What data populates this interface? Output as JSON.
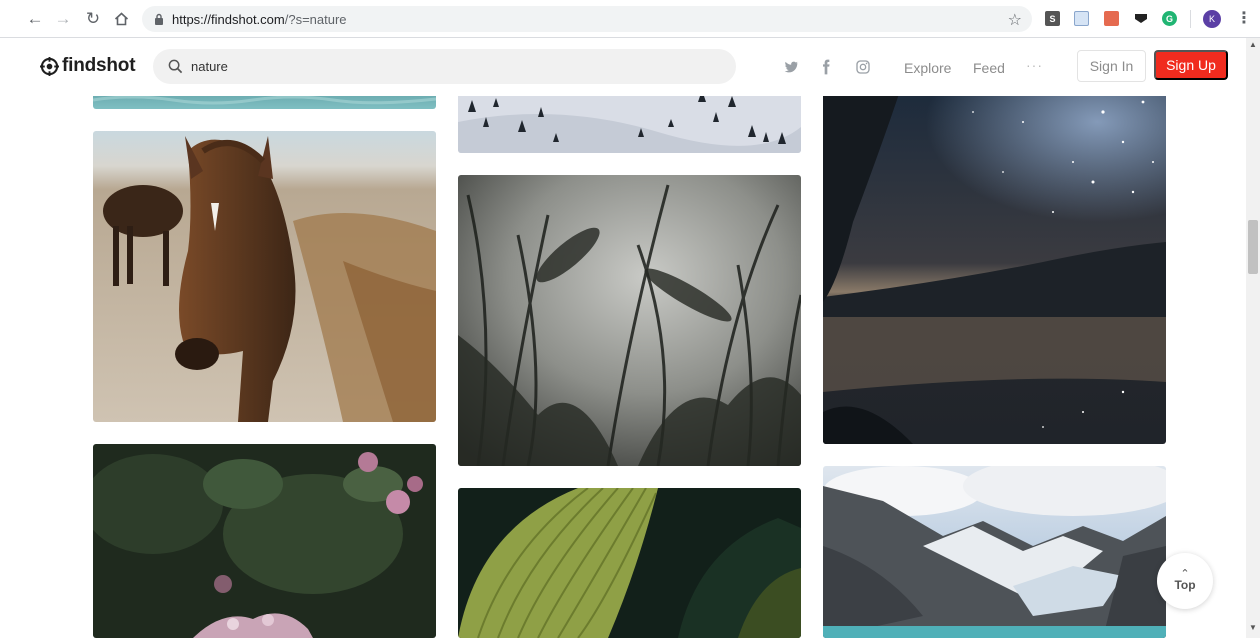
{
  "browser": {
    "url_host": "https://findshot.com",
    "url_path": "/?s=nature",
    "profile_initial": "K",
    "extensions": [
      "S-extension",
      "image-extension",
      "pdf-extension",
      "dark-extension",
      "green-extension"
    ]
  },
  "site": {
    "logo_text": "findshot",
    "search": {
      "value": "nature",
      "placeholder": ""
    },
    "social": [
      "twitter-icon",
      "facebook-icon",
      "instagram-icon"
    ],
    "nav": {
      "explore": "Explore",
      "feed": "Feed",
      "more": "···"
    },
    "buttons": {
      "sign_in": "Sign In",
      "sign_up": "Sign Up"
    },
    "accent": "#f02b1e"
  },
  "photos": [
    {
      "name": "photo-water-top",
      "subject": "water"
    },
    {
      "name": "photo-snow-forest",
      "subject": "snowy hillside"
    },
    {
      "name": "photo-horses",
      "subject": "horses"
    },
    {
      "name": "photo-grass-silhouette",
      "subject": "grass silhouette"
    },
    {
      "name": "photo-starry-lake",
      "subject": "starry night lake"
    },
    {
      "name": "photo-pink-flowers",
      "subject": "flowers"
    },
    {
      "name": "photo-green-leaf",
      "subject": "leaf"
    },
    {
      "name": "photo-mountains-glacier",
      "subject": "mountains"
    }
  ],
  "top_button": {
    "label": "Top"
  }
}
